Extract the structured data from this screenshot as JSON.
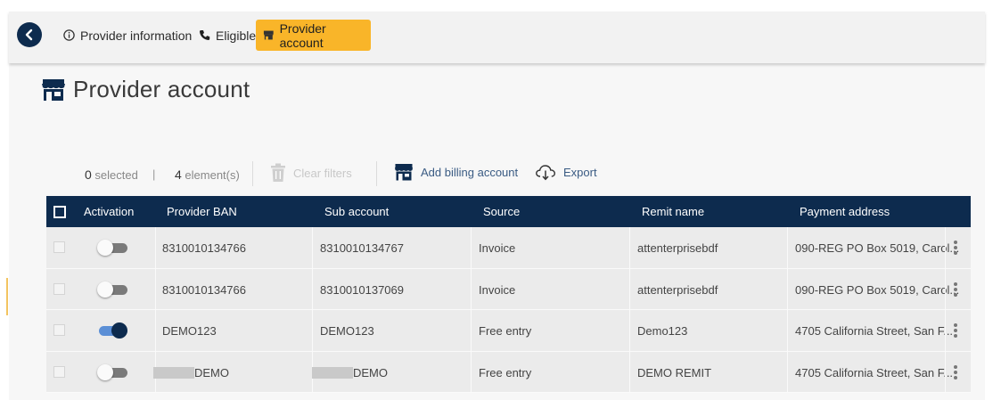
{
  "nav": {
    "provider_information": "Provider information",
    "eligible": "Eligible",
    "provider_account": "Provider account"
  },
  "page": {
    "title": "Provider account"
  },
  "toolbar": {
    "selected_count": "0",
    "selected_label": "selected",
    "separator": "|",
    "element_count": "4",
    "element_label": "element(s)",
    "clear_filters": "Clear filters",
    "add_billing_account": "Add billing account",
    "export": "Export"
  },
  "table": {
    "headers": [
      "Activation",
      "Provider BAN",
      "Sub account",
      "Source",
      "Remit name",
      "Payment address"
    ],
    "rows": [
      {
        "active": false,
        "provider_ban": "8310010134766",
        "sub_account": "8310010134767",
        "source": "Invoice",
        "remit_name": "attenterprisebdf",
        "payment_address": "090-REG PO Box 5019, Carol..."
      },
      {
        "active": false,
        "provider_ban": "8310010134766",
        "sub_account": "8310010137069",
        "source": "Invoice",
        "remit_name": "attenterprisebdf",
        "payment_address": "090-REG PO Box 5019, Carol..."
      },
      {
        "active": true,
        "provider_ban": "DEMO123",
        "sub_account": "DEMO123",
        "source": "Free entry",
        "remit_name": "Demo123",
        "payment_address": "4705 California Street, San F..."
      },
      {
        "active": false,
        "provider_ban": "DEMO",
        "sub_account": "DEMO",
        "source": "Free entry",
        "remit_name": "DEMO REMIT",
        "payment_address": "4705 California Street, San F..."
      }
    ]
  },
  "colors": {
    "navy": "#0d2b4e",
    "accent": "#f9b529",
    "toggle_on": "#5b8fd6"
  }
}
